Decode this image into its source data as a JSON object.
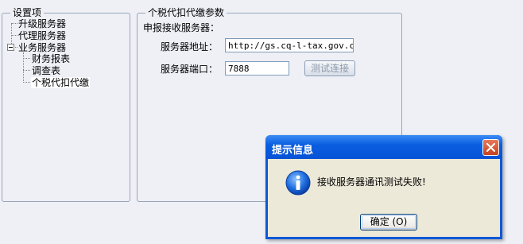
{
  "settings_panel": {
    "title": "设置项",
    "tree": [
      {
        "label": "升级服务器",
        "selected": false
      },
      {
        "label": "代理服务器",
        "selected": false
      },
      {
        "label": "业务服务器",
        "selected": false,
        "expanded": true,
        "children": [
          {
            "label": "财务报表",
            "selected": false
          },
          {
            "label": "调查表",
            "selected": false
          },
          {
            "label": "个税代扣代缴",
            "selected": true
          }
        ]
      }
    ]
  },
  "params_panel": {
    "title": "个税代扣代缴参数",
    "section_label": "申报接收服务器：",
    "address_label": "服务器地址：",
    "address_value": "http://gs.cq-l-tax.gov.cn",
    "port_label": "服务器端口：",
    "port_value": "7888",
    "test_button_label": "测试连接"
  },
  "dialog": {
    "title": "提示信息",
    "message": "接收服务器通讯测试失败!",
    "ok_label": "确定 (O)",
    "icon": "info-icon",
    "close_icon": "close-icon"
  }
}
